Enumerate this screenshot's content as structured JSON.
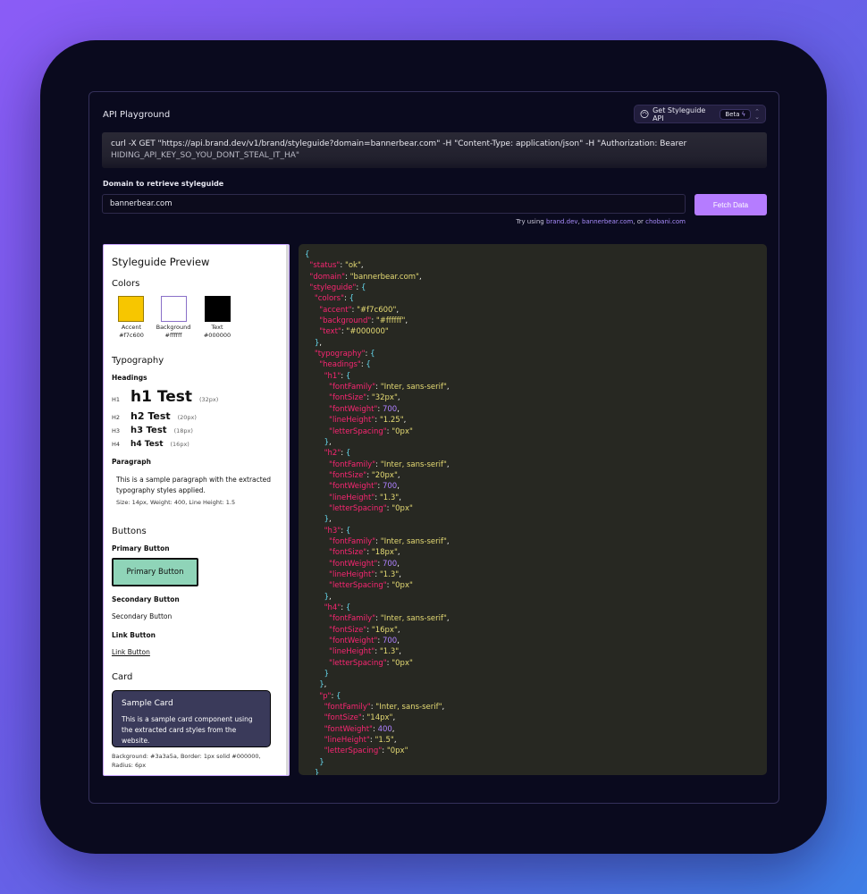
{
  "header": {
    "title": "API Playground",
    "api_select_label": "Get Styleguide API",
    "beta_label": "Beta"
  },
  "curl": {
    "line1": "curl -X GET \"https://api.brand.dev/v1/brand/styleguide?domain=bannerbear.com\" -H \"Content-Type: application/json\" -H \"Authorization: Bearer",
    "line2": "HIDING_API_KEY_SO_YOU_DONT_STEAL_IT_HA\""
  },
  "form": {
    "domain_label": "Domain to retrieve styleguide",
    "domain_value": "bannerbear.com",
    "fetch_label": "Fetch Data",
    "try_prefix": "Try using",
    "try_links": [
      "brand.dev",
      "bannerbear.com",
      "chobani.com"
    ],
    "try_sep1": ",",
    "try_sep2": ", or"
  },
  "preview": {
    "title": "Styleguide Preview",
    "colors_heading": "Colors",
    "colors": [
      {
        "name": "Accent",
        "hex": "#f7c600",
        "color": "#f7c600"
      },
      {
        "name": "Background",
        "hex": "#ffffff",
        "color": "#ffffff"
      },
      {
        "name": "Text",
        "hex": "#000000",
        "color": "#000000"
      }
    ],
    "typography_heading": "Typography",
    "headings_label": "Headings",
    "headings": [
      {
        "tag": "H1",
        "text": "h1 Test",
        "size": "(32px)"
      },
      {
        "tag": "H2",
        "text": "h2 Test",
        "size": "(20px)"
      },
      {
        "tag": "H3",
        "text": "h3 Test",
        "size": "(18px)"
      },
      {
        "tag": "H4",
        "text": "h4 Test",
        "size": "(16px)"
      }
    ],
    "paragraph_label": "Paragraph",
    "paragraph_text": "This is a sample paragraph with the extracted typography styles applied.",
    "paragraph_meta": "Size: 14px, Weight: 400, Line Height: 1.5",
    "buttons_heading": "Buttons",
    "primary_label": "Primary Button",
    "primary_button": "Primary Button",
    "secondary_label": "Secondary Button",
    "secondary_button": "Secondary Button",
    "link_label": "Link Button",
    "link_button": "Link Button",
    "card_heading": "Card",
    "card_title": "Sample Card",
    "card_body": "This is a sample card component using the extracted card styles from the website.",
    "card_meta": "Background: #3a3a5a, Border: 1px solid #000000, Radius: 6px"
  },
  "json_response": {
    "status": "ok",
    "domain": "bannerbear.com",
    "styleguide": {
      "colors": {
        "accent": "#f7c600",
        "background": "#ffffff",
        "text": "#000000"
      },
      "typography": {
        "headings": {
          "h1": {
            "fontFamily": "Inter, sans-serif",
            "fontSize": "32px",
            "fontWeight": 700,
            "lineHeight": "1.25",
            "letterSpacing": "0px"
          },
          "h2": {
            "fontFamily": "Inter, sans-serif",
            "fontSize": "20px",
            "fontWeight": 700,
            "lineHeight": "1.3",
            "letterSpacing": "0px"
          },
          "h3": {
            "fontFamily": "Inter, sans-serif",
            "fontSize": "18px",
            "fontWeight": 700,
            "lineHeight": "1.3",
            "letterSpacing": "0px"
          },
          "h4": {
            "fontFamily": "Inter, sans-serif",
            "fontSize": "16px",
            "fontWeight": 700,
            "lineHeight": "1.3",
            "letterSpacing": "0px"
          }
        },
        "p": {
          "fontFamily": "Inter, sans-serif",
          "fontSize": "14px",
          "fontWeight": 400,
          "lineHeight": "1.5",
          "letterSpacing": "0px"
        }
      }
    }
  },
  "icons": [
    "palette-icon",
    "bolt-icon",
    "chevron-updown-icon"
  ]
}
